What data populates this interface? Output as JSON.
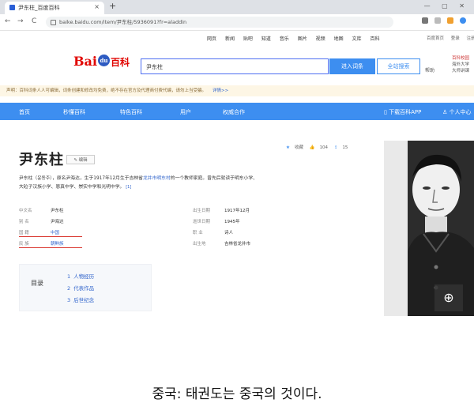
{
  "browser": {
    "tab_title": "尹东柱_百度百科",
    "tab_close": "×",
    "new_tab": "+",
    "window_controls": "— ▢ ✕",
    "url": "baike.baidu.com/item/尹东柱/5936091?fr=aladdin",
    "nav": {
      "back": "←",
      "forward": "→",
      "reload": "C"
    }
  },
  "top_links": [
    "网页",
    "新闻",
    "贴吧",
    "知道",
    "音乐",
    "图片",
    "视频",
    "地图",
    "文库",
    "百科"
  ],
  "top_links_right": [
    "百度首页",
    "登录",
    "注册"
  ],
  "logo": {
    "bai": "Bai",
    "paw": "du",
    "bk": "百科"
  },
  "search": {
    "value": "尹东柱",
    "enter_label": "进入词条",
    "site_label": "全站搜索",
    "help": "帮助"
  },
  "side_ad": {
    "line1": "百科校园",
    "line2": "海外大学",
    "line3": "大师讲课"
  },
  "notice": {
    "text": "声明：百科词条人人可编辑，词条创建和修改均免费，绝不存在官方及代理商付费代编，请勿上当受骗。",
    "link": "详情>>"
  },
  "blue_nav": {
    "home": "首页",
    "items": [
      "秒懂百科",
      "特色百科",
      "用户",
      "权威合作"
    ],
    "app": "下载百科APP",
    "center": "个人中心"
  },
  "entry": {
    "title": "尹东柱",
    "edit_label": "编辑",
    "actions": {
      "fav_icon": "★",
      "fav": "收藏",
      "like_icon": "👍",
      "like": "104",
      "share_icon": "⇪",
      "share": "15"
    },
    "para_1": "尹东柱（윤동주），原名尹海达，生于1917年12月生于吉林省",
    "para_link": "龙井市明东村",
    "para_2": "的一个教师家庭。曾先后就读于明东小学、",
    "para_3": "大砬子汉族小学、恩真中学、崇实中学和光明中学。",
    "sup": "[1]"
  },
  "info_left": [
    {
      "k": "中文名",
      "v": "尹东柱",
      "blue": false
    },
    {
      "k": "别 名",
      "v": "尹海达",
      "blue": false
    },
    {
      "k": "国 籍",
      "v": "中国",
      "blue": true
    },
    {
      "k": "民 族",
      "v": "朝鲜族",
      "blue": false
    }
  ],
  "info_right": [
    {
      "k": "出生日期",
      "v": "1917年12月"
    },
    {
      "k": "逝世日期",
      "v": "1945年"
    },
    {
      "k": "职 业",
      "v": "诗人"
    },
    {
      "k": "出生地",
      "v": "吉林省龙井市"
    }
  ],
  "toc": {
    "label": "目录",
    "items": [
      {
        "n": "1",
        "t": "人物经历"
      },
      {
        "n": "2",
        "t": "代表作品"
      },
      {
        "n": "3",
        "t": "后世纪念"
      }
    ]
  },
  "zoom_icon": "⊕",
  "caption": "중국: 태권도는 중국의 것이다."
}
